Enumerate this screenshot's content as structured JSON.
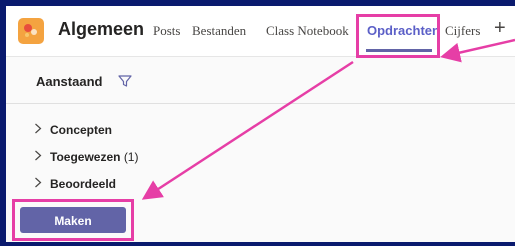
{
  "header": {
    "team_name": "Algemeen",
    "tabs": [
      {
        "label": "Posts",
        "active": false
      },
      {
        "label": "Bestanden",
        "active": false
      },
      {
        "label": "Class Notebook",
        "active": false
      },
      {
        "label": "Opdrachten",
        "active": true
      },
      {
        "label": "Cijfers",
        "active": false
      }
    ],
    "add_tab_label": "+"
  },
  "filter": {
    "label": "Aanstaand",
    "icon": "filter-icon"
  },
  "groups": [
    {
      "label": "Concepten",
      "count": ""
    },
    {
      "label": "Toegewezen",
      "count": "(1)"
    },
    {
      "label": "Beoordeeld",
      "count": ""
    }
  ],
  "actions": {
    "create_label": "Maken"
  },
  "colors": {
    "accent": "#6264a7",
    "highlight": "#e63ea6",
    "frame_border": "#0a1a6e",
    "team_avatar": "#f4a340"
  }
}
